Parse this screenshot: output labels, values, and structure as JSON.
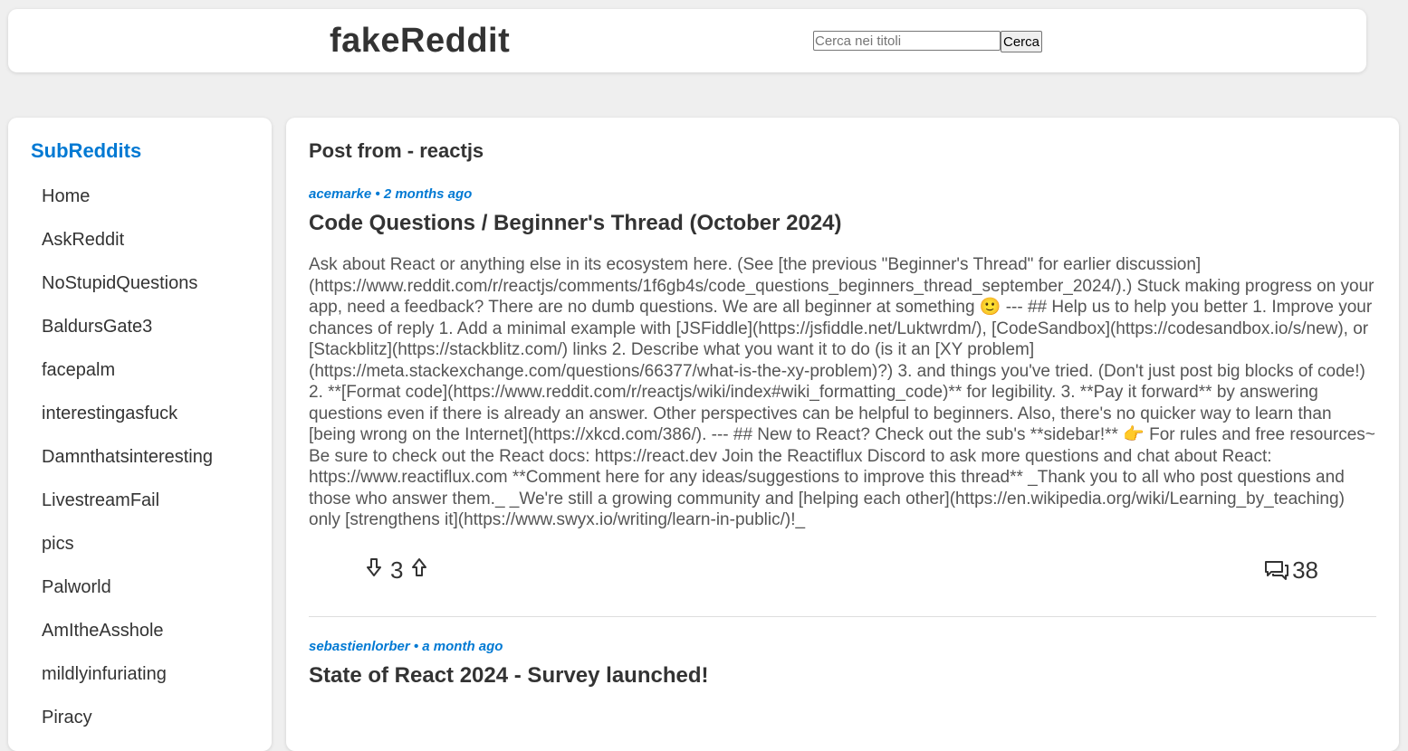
{
  "header": {
    "brand": "fakeReddit",
    "search_placeholder": "Cerca nei titoli",
    "search_button": "Cerca"
  },
  "sidebar": {
    "title": "SubReddits",
    "items": [
      {
        "label": "Home"
      },
      {
        "label": "AskReddit"
      },
      {
        "label": "NoStupidQuestions"
      },
      {
        "label": "BaldursGate3"
      },
      {
        "label": "facepalm"
      },
      {
        "label": "interestingasfuck"
      },
      {
        "label": "Damnthatsinteresting"
      },
      {
        "label": "LivestreamFail"
      },
      {
        "label": "pics"
      },
      {
        "label": "Palworld"
      },
      {
        "label": "AmItheAsshole"
      },
      {
        "label": "mildlyinfuriating"
      },
      {
        "label": "Piracy"
      }
    ]
  },
  "main": {
    "heading": "Post from - reactjs",
    "posts": [
      {
        "meta": "acemarke • 2 months ago",
        "title": "Code Questions / Beginner's Thread (October 2024)",
        "body": "Ask about React or anything else in its ecosystem here. (See [the previous \"Beginner's Thread\" for earlier discussion](https://www.reddit.com/r/reactjs/comments/1f6gb4s/code_questions_beginners_thread_september_2024/).) Stuck making progress on your app, need a feedback? There are no dumb questions. We are all beginner at something 🙂 --- ## Help us to help you better 1. Improve your chances of reply 1. Add a minimal example with [JSFiddle](https://jsfiddle.net/Luktwrdm/), [CodeSandbox](https://codesandbox.io/s/new), or [Stackblitz](https://stackblitz.com/) links 2. Describe what you want it to do (is it an [XY problem](https://meta.stackexchange.com/questions/66377/what-is-the-xy-problem)?) 3. and things you've tried. (Don't just post big blocks of code!) 2. **[Format code](https://www.reddit.com/r/reactjs/wiki/index#wiki_formatting_code)** for legibility. 3. **Pay it forward** by answering questions even if there is already an answer. Other perspectives can be helpful to beginners. Also, there's no quicker way to learn than [being wrong on the Internet](https://xkcd.com/386/). --- ## New to React? Check out the sub's **sidebar!** 👉 For rules and free resources~ Be sure to check out the React docs: https://react.dev Join the Reactiflux Discord to ask more questions and chat about React: https://www.reactiflux.com **Comment here for any ideas/suggestions to improve this thread** _Thank you to all who post questions and those who answer them._ _We're still a growing community and [helping each other](https://en.wikipedia.org/wiki/Learning_by_teaching) only [strengthens it](https://www.swyx.io/writing/learn-in-public/)!_",
        "votes": "3",
        "comments": "38"
      },
      {
        "meta": "sebastienlorber • a month ago",
        "title": "State of React 2024 - Survey launched!"
      }
    ]
  },
  "colors": {
    "accent": "#0079d3",
    "background": "#efefef",
    "card": "#ffffff"
  }
}
